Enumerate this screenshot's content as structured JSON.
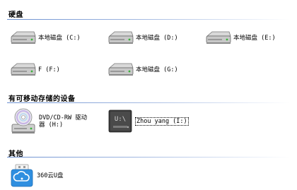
{
  "groups": {
    "hard_disks": "硬盘",
    "removable": "有可移动存储的设备",
    "other": "其他"
  },
  "hard_disks": [
    {
      "label": "本地磁盘 (C:)",
      "icon": "hard-disk-icon"
    },
    {
      "label": "本地磁盘 (D:)",
      "icon": "hard-disk-icon"
    },
    {
      "label": "本地磁盘 (E:)",
      "icon": "hard-disk-icon"
    },
    {
      "label": "F (F:)",
      "icon": "hard-disk-icon"
    },
    {
      "label": "本地磁盘 (G:)",
      "icon": "hard-disk-icon"
    }
  ],
  "removable": [
    {
      "label": "DVD/CD-RW 驱动器 (H:)",
      "icon": "dvd-drive-icon"
    },
    {
      "label": "Zhou yang (I:)",
      "icon": "usb-drive-icon",
      "selected": true
    }
  ],
  "other": [
    {
      "label": "360云U盘",
      "icon": "cloud-usb-icon"
    }
  ],
  "colors": {
    "header_line": "#6a8fd0",
    "usb_drive_dark": "#3d3d3d",
    "cloud_blue": "#2f8fe0"
  }
}
